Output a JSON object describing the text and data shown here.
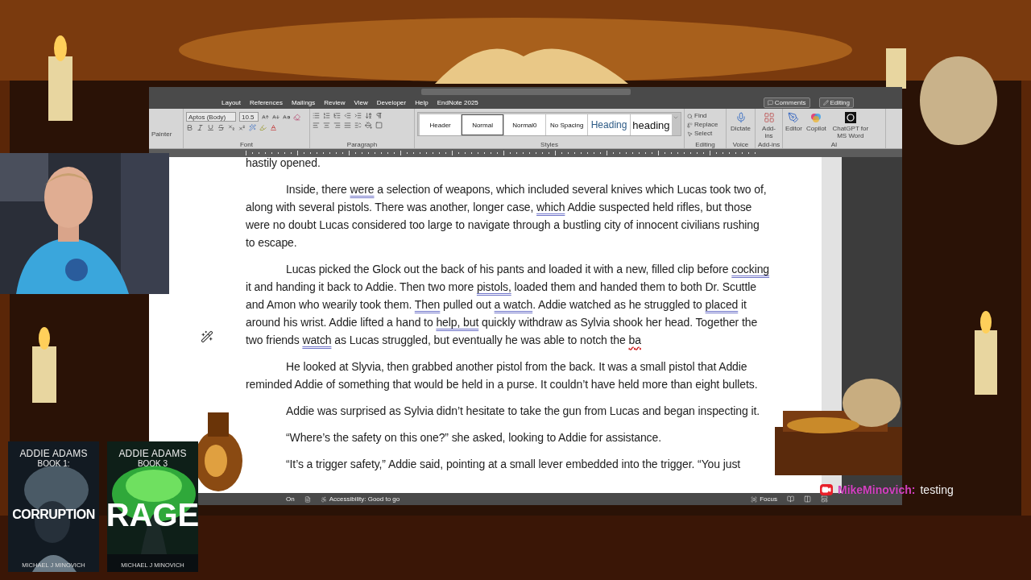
{
  "ribbon": {
    "tabs": [
      {
        "label": "Layout",
        "selected": false
      },
      {
        "label": "References",
        "selected": false
      },
      {
        "label": "Mailings",
        "selected": false
      },
      {
        "label": "Review",
        "selected": false
      },
      {
        "label": "View",
        "selected": false
      },
      {
        "label": "Developer",
        "selected": false
      },
      {
        "label": "Help",
        "selected": false
      },
      {
        "label": "EndNote 2025",
        "selected": false
      }
    ],
    "comments": "Comments",
    "editing_mode": "Editing",
    "clipboard_label": "Painter",
    "font": {
      "name": "Aptos (Body)",
      "size": "10.5",
      "label": "Font"
    },
    "paragraph": {
      "label": "Paragraph"
    },
    "styles": {
      "label": "Styles",
      "items": [
        {
          "label": "Header",
          "kind": "plain",
          "selected": false
        },
        {
          "label": "Normal",
          "kind": "plain",
          "selected": true
        },
        {
          "label": "Normal0",
          "kind": "plain",
          "selected": false
        },
        {
          "label": "No Spacing",
          "kind": "small",
          "selected": false
        },
        {
          "label": "Heading",
          "kind": "heading",
          "selected": false
        },
        {
          "label": "heading",
          "kind": "large",
          "selected": false
        }
      ]
    },
    "editing": {
      "label": "Editing",
      "find": "Find",
      "replace": "Replace",
      "select": "Select"
    },
    "voice": {
      "button": "Dictate",
      "label": "Voice"
    },
    "addins": {
      "button": "Add-ins",
      "label": "Add-ins"
    },
    "ai": {
      "editor": "Editor",
      "copilot": "Copilot",
      "chatgpt": "ChatGPT for MS Word",
      "label": "AI"
    }
  },
  "document": {
    "paragraphs": [
      {
        "indent": false,
        "segments": [
          {
            "text": "hastily opened."
          }
        ]
      },
      {
        "indent": true,
        "segments": [
          {
            "text": "Inside, there "
          },
          {
            "text": "were",
            "grammar_flag": true
          },
          {
            "text": " a selection of weapons, which included several knives which Lucas took two of, along with several pistols. There was another, longer case, "
          },
          {
            "text": "which",
            "grammar_flag": true
          },
          {
            "text": " Addie suspected held rifles, but those were no doubt Lucas considered too large to navigate through a bustling city of innocent civilians rushing to escape."
          }
        ]
      },
      {
        "indent": true,
        "segments": [
          {
            "text": "Lucas picked the Glock out the back of his pants and loaded it with a new, filled clip before "
          },
          {
            "text": "cocking",
            "grammar_flag": true
          },
          {
            "text": " it and handing it back to Addie. Then two more "
          },
          {
            "text": "pistols,",
            "grammar_flag": true
          },
          {
            "text": " loaded them and handed them to both Dr. Scuttle and Amon who wearily took them. "
          },
          {
            "text": "Then",
            "grammar_flag": true
          },
          {
            "text": " pulled out "
          },
          {
            "text": "a watch",
            "grammar_flag": true
          },
          {
            "text": ". Addie watched as he struggled to "
          },
          {
            "text": "placed",
            "grammar_flag": true
          },
          {
            "text": " it around his wrist. Addie lifted a hand to "
          },
          {
            "text": "help, but",
            "grammar_flag": true
          },
          {
            "text": " quickly withdraw as Sylvia shook her head. Together the two friends "
          },
          {
            "text": "watch",
            "grammar_flag": true
          },
          {
            "text": " as Lucas struggled, but eventually he was able to notch the "
          },
          {
            "text": "ba",
            "spelling_flag": true
          }
        ]
      },
      {
        "indent": true,
        "segments": [
          {
            "text": "He looked at Slyvia, then grabbed another pistol from the back. It was a small pistol that Addie reminded Addie of something that would be held in a purse. It couldn’t have held more than eight bullets."
          }
        ]
      },
      {
        "indent": true,
        "segments": [
          {
            "text": "Addie was surprised as Sylvia didn’t hesitate to take the gun from Lucas and began inspecting it."
          }
        ]
      },
      {
        "indent": true,
        "segments": [
          {
            "text": "“Where’s the safety on this one?” she asked, looking to Addie for assistance."
          }
        ]
      },
      {
        "indent": true,
        "segments": [
          {
            "text": "“It’s a trigger safety,” Addie said, pointing at a small lever embedded into the trigger. “You just"
          }
        ]
      }
    ]
  },
  "status_bar": {
    "mode": "On",
    "accessibility": "Accessibility: Good to go",
    "focus": "Focus"
  },
  "chat": {
    "user": "MikeMinovich:",
    "message": "testing"
  },
  "books": [
    {
      "kind": "dark",
      "series": "ADDIE ADAMS",
      "volume": "BOOK 1:",
      "title": "CORRUPTION",
      "author": "MICHAEL J MINOVICH"
    },
    {
      "kind": "green",
      "series": "ADDIE ADAMS",
      "volume": "BOOK 3",
      "title": "RAGE",
      "author": "MICHAEL J MINOVICH"
    }
  ]
}
